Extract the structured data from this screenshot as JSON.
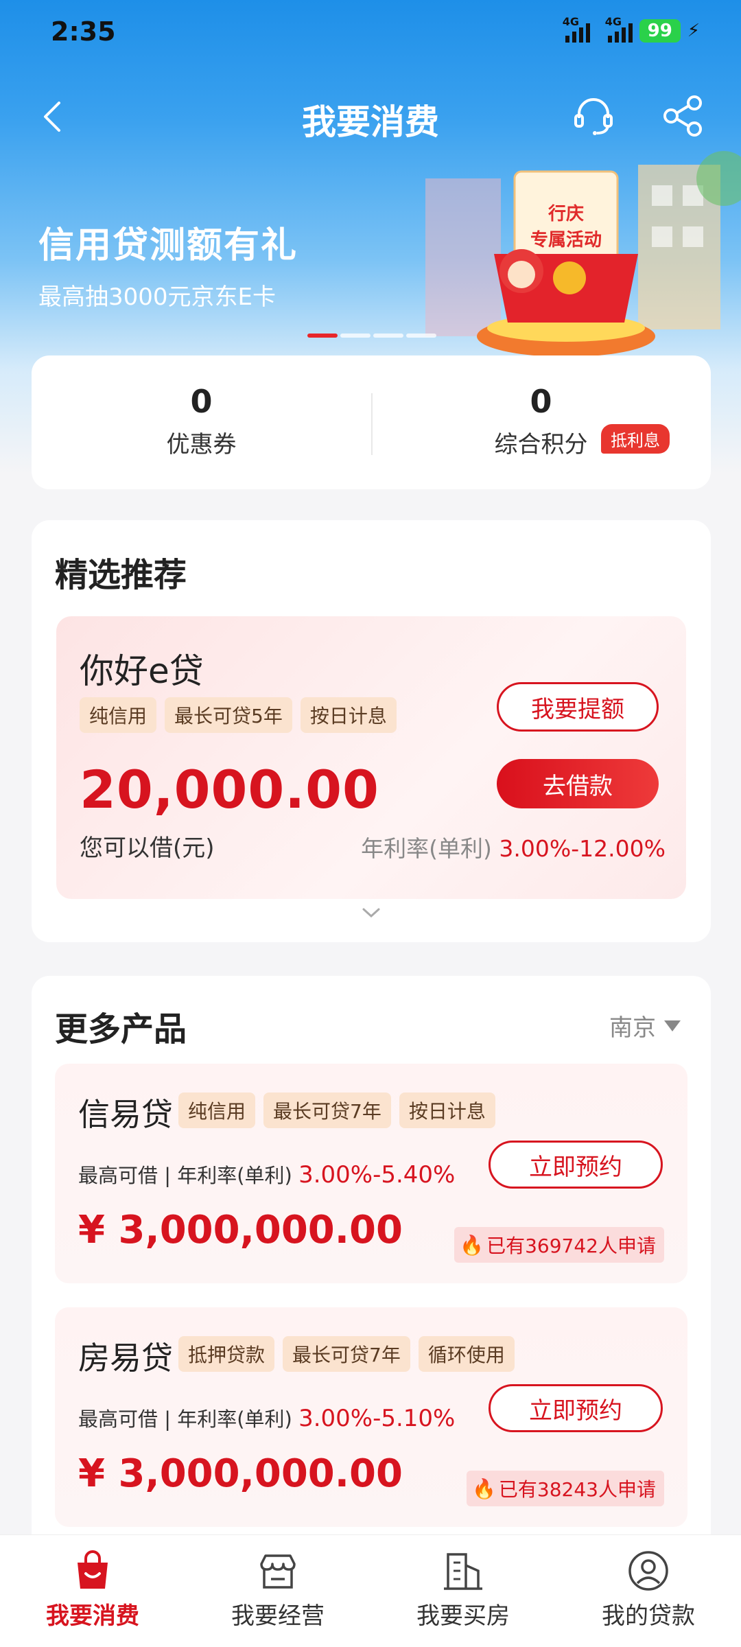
{
  "status": {
    "time": "2:35",
    "net1": "4G",
    "net2": "4G",
    "battery": "99"
  },
  "header": {
    "title": "我要消费"
  },
  "banner": {
    "title": "信用贷测额有礼",
    "subtitle": "最高抽3000元京东E卡",
    "illustration_text_1": "行庆",
    "illustration_text_2": "专属活动"
  },
  "stats": {
    "coupons": {
      "value": "0",
      "label": "优惠券"
    },
    "points": {
      "value": "0",
      "label": "综合积分",
      "badge": "抵利息"
    }
  },
  "recommend": {
    "title": "精选推荐",
    "product": {
      "name": "你好e贷",
      "tags": [
        "纯信用",
        "最长可贷5年",
        "按日计息"
      ],
      "amount": "20,000.00",
      "amount_label": "您可以借(元)",
      "rate_label": "年利率(单利)",
      "rate": "3.00%-12.00%",
      "btn_raise": "我要提额",
      "btn_borrow": "去借款"
    }
  },
  "more": {
    "title": "更多产品",
    "city": "南京",
    "products": [
      {
        "name": "信易贷",
        "tags": [
          "纯信用",
          "最长可贷7年",
          "按日计息"
        ],
        "line_label": "最高可借 | 年利率(单利)",
        "rate": "3.00%-5.40%",
        "amount": "¥ 3,000,000.00",
        "button": "立即预约",
        "applied": "已有369742人申请"
      },
      {
        "name": "房易贷",
        "tags": [
          "抵押贷款",
          "最长可贷7年",
          "循环使用"
        ],
        "line_label": "最高可借 | 年利率(单利)",
        "rate": "3.00%-5.10%",
        "amount": "¥ 3,000,000.00",
        "button": "立即预约",
        "applied": "已有38243人申请"
      }
    ]
  },
  "nav": [
    {
      "label": "我要消费",
      "icon": "shopping-bag-icon"
    },
    {
      "label": "我要经营",
      "icon": "store-icon"
    },
    {
      "label": "我要买房",
      "icon": "building-icon"
    },
    {
      "label": "我的贷款",
      "icon": "user-icon"
    }
  ],
  "colors": {
    "accent": "#d7141f",
    "header_blue": "#1e8fe8"
  }
}
